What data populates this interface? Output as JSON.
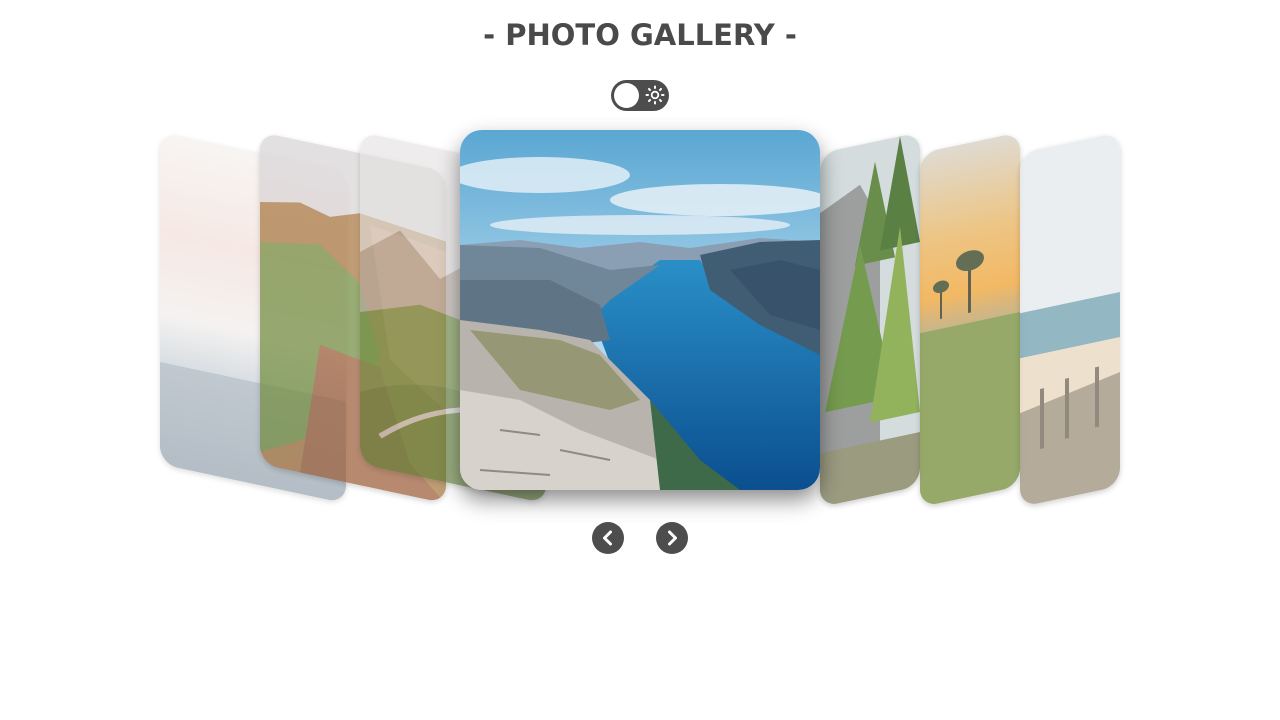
{
  "header": {
    "title": "- PHOTO GALLERY -"
  },
  "theme_toggle": {
    "state": "off",
    "icon": "sun-icon"
  },
  "gallery": {
    "slides": [
      {
        "position": "far-left",
        "subject": "misty seashore"
      },
      {
        "position": "left",
        "subject": "coastal cliffs"
      },
      {
        "position": "near-left",
        "subject": "mountain valley road"
      },
      {
        "position": "center",
        "subject": "fjord from cliff top"
      },
      {
        "position": "near-right",
        "subject": "pine forest by rock wall"
      },
      {
        "position": "right",
        "subject": "sunset over savanna trees"
      },
      {
        "position": "far-right",
        "subject": "beach boardwalk"
      }
    ]
  },
  "navigation": {
    "prev_icon": "chevron-left-icon",
    "next_icon": "chevron-right-icon"
  },
  "colors": {
    "title": "#4a4a4a",
    "controls": "#4d4d4d",
    "background": "#ffffff"
  }
}
